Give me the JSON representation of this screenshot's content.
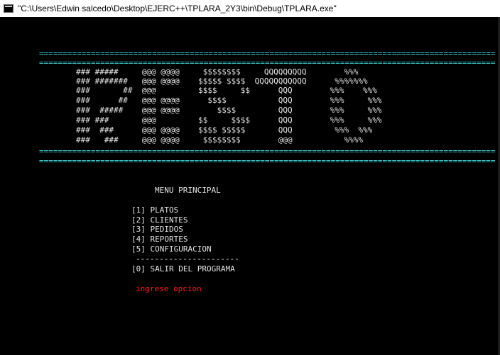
{
  "window": {
    "title": "\"C:\\Users\\Edwin salcedo\\Desktop\\EJERC++\\TPLARA_2Y3\\bin\\Debug\\TPLARA.exe\""
  },
  "banner": {
    "border_top_1": "=================================================================================================",
    "border_top_2": "=================================================================================================",
    "art": [
      "### #####     @@@ @@@@     $$$$$$$$     QQQQQQQQQ        %%%",
      "### #######   @@@ @@@@    $$$$$ $$$$  QQQQQQQQQQQ      %%%%%%%",
      "###       ##  @@@         $$$$     $$      QQQ        %%%    %%%",
      "###      ##   @@@ @@@@      $$$$           QQQ        %%%     %%%",
      "###  #####    @@@ @@@@        $$$$         QQQ        %%%     %%%",
      "### ###       @@@         $$     $$$$      QQQ        %%%     %%%",
      "###  ###      @@@ @@@@    $$$$ $$$$$       QQQ         %%%  %%%",
      "###   ###     @@@ @@@@     $$$$$$$$        @@@           %%%%"
    ],
    "border_bottom_1": "=================================================================================================",
    "border_bottom_2": "================================================================================================="
  },
  "menu": {
    "title": "MENU PRINCIPAL",
    "items": [
      "[1] PLATOS",
      "[2] CLIENTES",
      "[3] PEDIDOS",
      "[4] REPORTES",
      "[5] CONFIGURACION"
    ],
    "separator": "----------------------",
    "exit": "[0] SALIR DEL PROGRAMA",
    "prompt": "ingrese opcion"
  },
  "colors": {
    "background": "#000000",
    "border": "#3fd9d9",
    "text": "#e6e6e6",
    "prompt": "#ff1b1b"
  }
}
